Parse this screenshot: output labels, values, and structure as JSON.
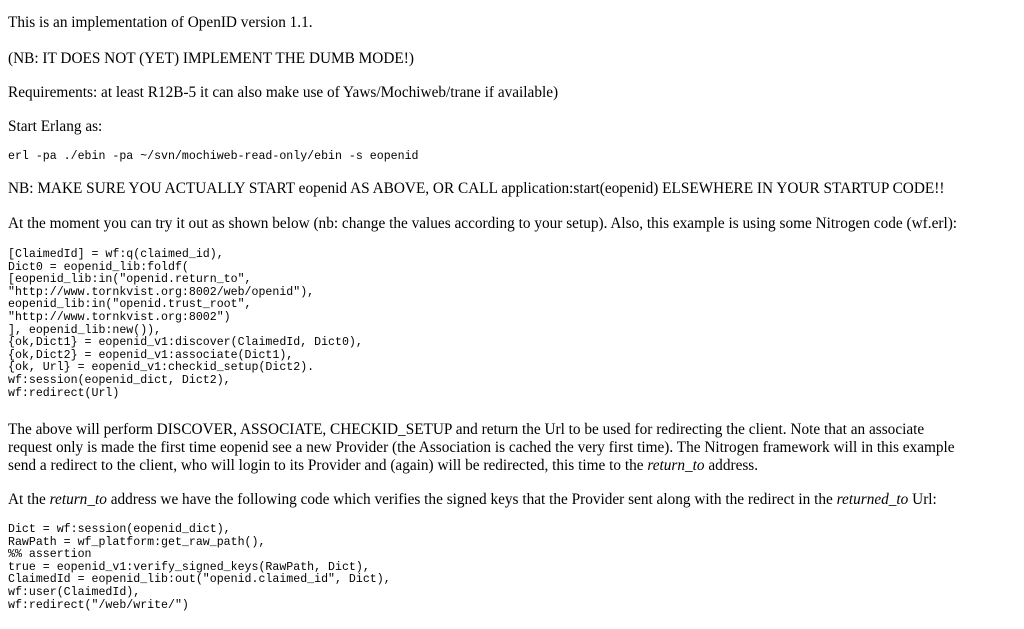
{
  "intro": "This is an implementation of OpenID version 1.1.",
  "nb_dumb": "(NB: IT DOES NOT (YET) IMPLEMENT THE DUMB MODE!)",
  "requirements": "Requirements: at least R12B-5 it can also make use of Yaws/Mochiweb/trane if available)",
  "start_label": "Start Erlang as:",
  "start_cmd": "erl -pa ./ebin -pa ~/svn/mochiweb-read-only/ebin -s eopenid",
  "nb_start": "NB: MAKE SURE YOU ACTUALLY START eopenid AS ABOVE, OR CALL application:start(eopenid) ELSEWHERE IN YOUR STARTUP CODE!!",
  "try_it": "At the moment you can try it out as shown below (nb: change the values according to your setup). Also, this example is using some Nitrogen code (wf.erl):",
  "code1": [
    "[ClaimedId] = wf:q(claimed_id),",
    "Dict0 = eopenid_lib:foldf(",
    "          [eopenid_lib:in(\"openid.return_to\",",
    "                           \"http://www.tornkvist.org:8002/web/openid\"),",
    "           eopenid_lib:in(\"openid.trust_root\",",
    "                           \"http://www.tornkvist.org:8002\")",
    "          ], eopenid_lib:new()),",
    "{ok,Dict1} = eopenid_v1:discover(ClaimedId, Dict0),",
    "{ok,Dict2} = eopenid_v1:associate(Dict1),",
    "{ok, Url}  = eopenid_v1:checkid_setup(Dict2).",
    "wf:session(eopenid_dict, Dict2),",
    "wf:redirect(Url)"
  ],
  "above": {
    "line1": "The above will perform DISCOVER, ASSOCIATE, CHECKID_SETUP and return the Url to be used for redirecting the client. Note that an associate",
    "line2": "request only is made the first time eopenid see a new Provider (the Association is cached the very first time). The Nitrogen framework will in this example",
    "line3_pre": "send a redirect to the client, who will login to its Provider and (again) will be redirected, this time to the ",
    "line3_em": "return_to",
    "line3_post": " address."
  },
  "at_return": {
    "pre": "At the ",
    "em1": "return_to",
    "mid": " address we have the following code which verifies the signed keys that the Provider sent along with the redirect in the ",
    "em2": "returned_to",
    "post": " Url:"
  },
  "code2": [
    "Dict = wf:session(eopenid_dict),",
    "RawPath = wf_platform:get_raw_path(),",
    "%% assertion",
    "true = eopenid_v1:verify_signed_keys(RawPath, Dict),",
    "ClaimedId = eopenid_lib:out(\"openid.claimed_id\", Dict),",
    "wf:user(ClaimedId),",
    "wf:redirect(\"/web/write/\")"
  ]
}
